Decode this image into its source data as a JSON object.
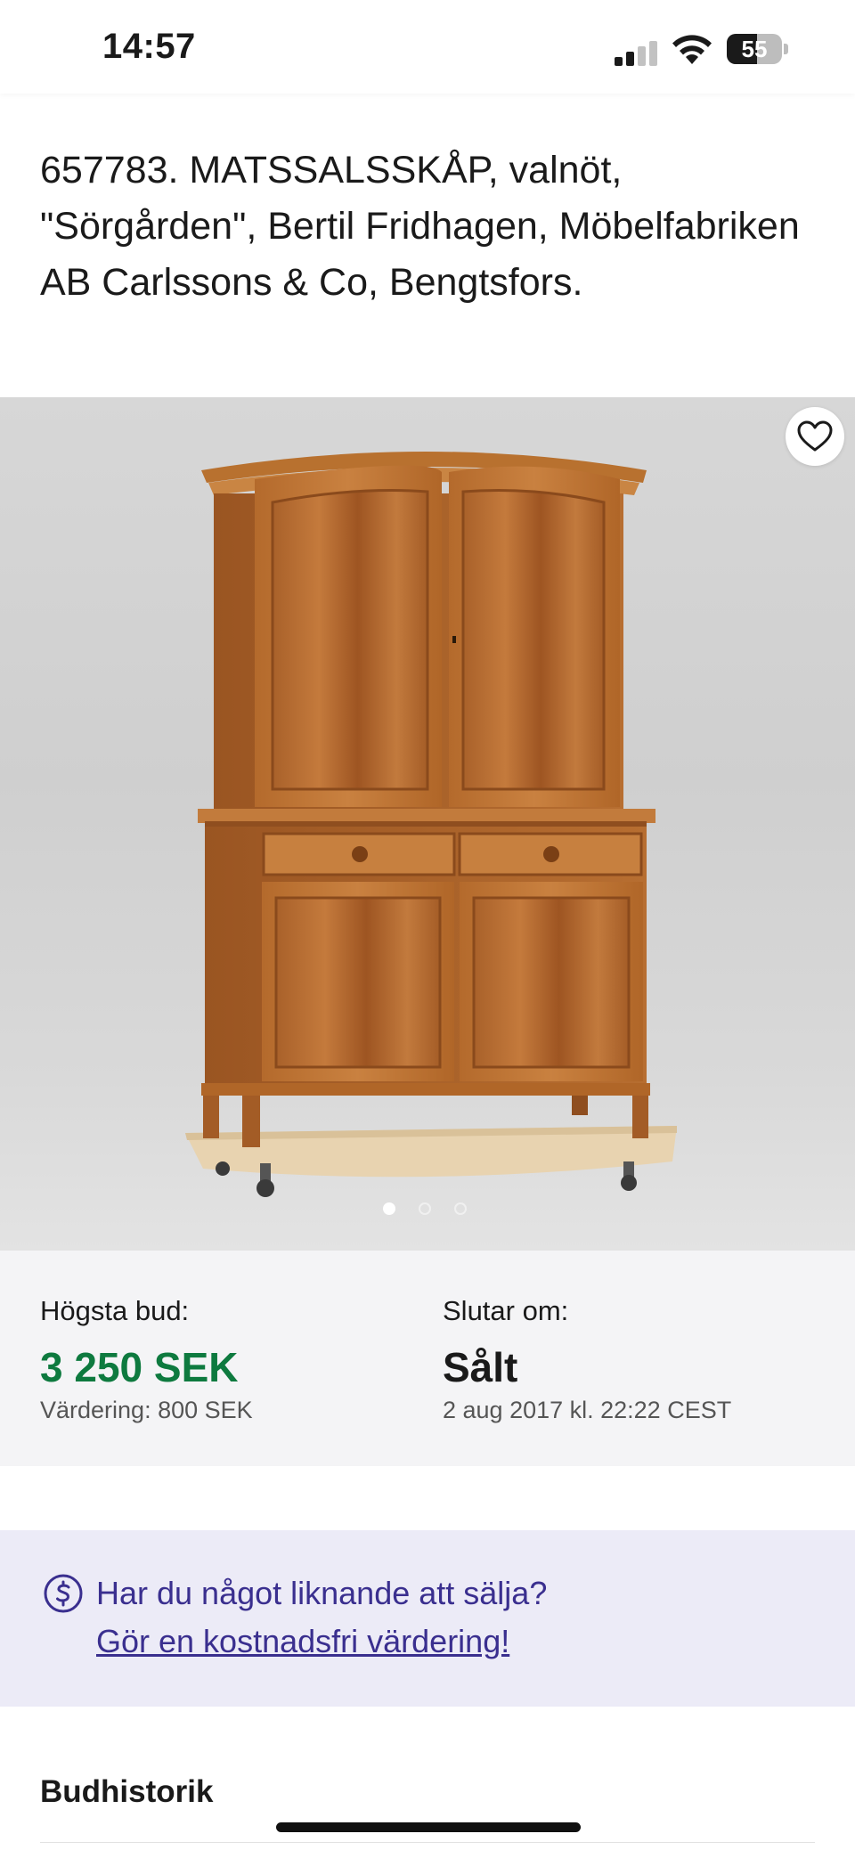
{
  "status_bar": {
    "time": "14:57",
    "battery_level": "55",
    "battery_fraction": 0.55,
    "signal_bars_active": 2,
    "signal_bars_total": 4,
    "icons": [
      "cellular-signal-icon",
      "wifi-icon",
      "battery-icon"
    ]
  },
  "listing": {
    "title": "657783. MATSSALSSKÅP, valnöt, \"Sörgården\", Bertil Fridhagen, Möbelfabriken AB Carlssons & Co, Bengtsfors.",
    "image_alt": "cabinet-photo",
    "image_count": 3,
    "active_image": 0
  },
  "bid": {
    "highest_label": "Högsta bud:",
    "highest_value": "3 250 SEK",
    "valuation": "Värdering: 800 SEK",
    "ends_label": "Slutar om:",
    "status": "Sålt",
    "end_date": "2 aug 2017 kl. 22:22 CEST"
  },
  "promo": {
    "question": "Har du något liknande att sälja?",
    "link": "Gör en kostnadsfri värdering!"
  },
  "bid_history": {
    "title": "Budhistorik"
  },
  "colors": {
    "bid_green": "#0e7a3f",
    "promo_bg": "#ecebf7",
    "promo_text": "#3a2f8f",
    "panel_bg": "#f4f4f6"
  }
}
